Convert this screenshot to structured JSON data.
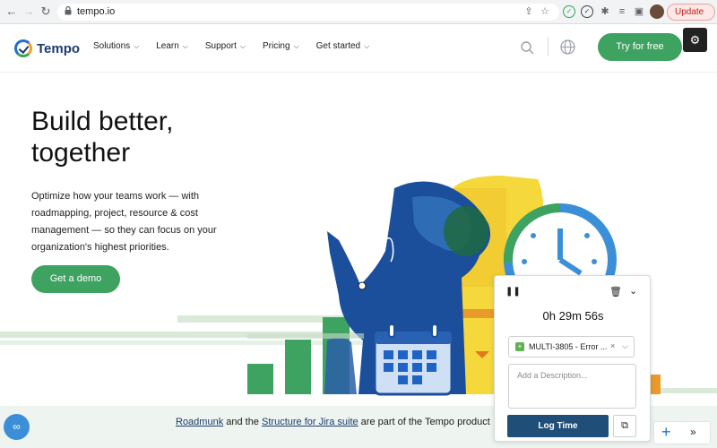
{
  "browser": {
    "url": "tempo.io",
    "update_label": "Update"
  },
  "header": {
    "logo_text": "Tempo",
    "nav": [
      {
        "label": "Solutions"
      },
      {
        "label": "Learn"
      },
      {
        "label": "Support"
      },
      {
        "label": "Pricing"
      },
      {
        "label": "Get started"
      }
    ],
    "cta_label": "Try for free"
  },
  "hero": {
    "title": "Build better, together",
    "body": "Optimize how your teams work — with roadmapping, project, resource & cost management — so they can focus on your organization's highest priorities.",
    "cta_label": "Get a demo"
  },
  "footer": {
    "link1": "Roadmunk",
    "text1": " and the ",
    "link2": "Structure for Jira suite",
    "text2": " are part of the Tempo product"
  },
  "timer": {
    "elapsed": "0h 29m 56s",
    "issue": "MULTI-3805 - Error ...",
    "description_placeholder": "Add a Description...",
    "log_label": "Log Time"
  },
  "colors": {
    "brand_green": "#3ea360",
    "brand_navy": "#1b3b6f",
    "log_button": "#1f4e79"
  }
}
